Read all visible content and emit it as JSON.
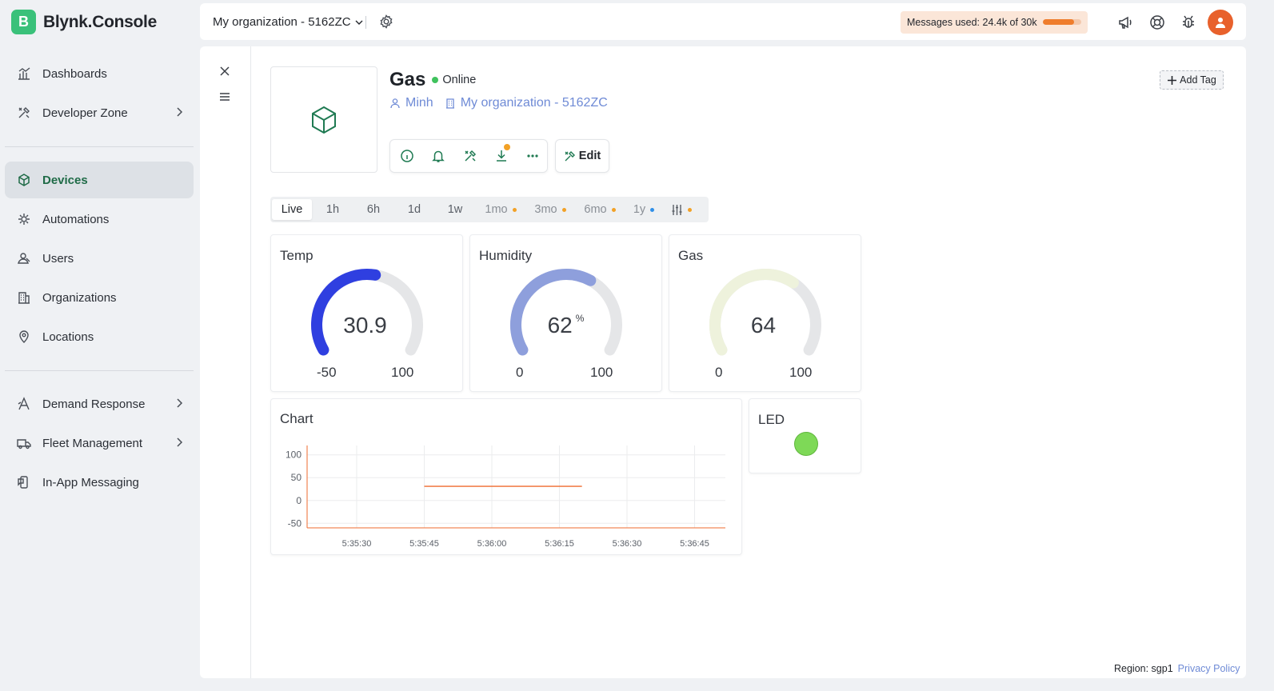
{
  "brand": {
    "logo_letter": "B",
    "name": "Blynk.Console",
    "color": "#3ac17a"
  },
  "sidebar": {
    "items": [
      {
        "label": "Dashboards",
        "icon": "dashboard-icon"
      },
      {
        "label": "Developer Zone",
        "icon": "tools-icon",
        "expandable": true
      },
      {
        "label": "Devices",
        "icon": "cube-icon",
        "active": true
      },
      {
        "label": "Automations",
        "icon": "automation-icon"
      },
      {
        "label": "Users",
        "icon": "users-icon"
      },
      {
        "label": "Organizations",
        "icon": "building-icon"
      },
      {
        "label": "Locations",
        "icon": "location-pin-icon"
      },
      {
        "label": "Demand Response",
        "icon": "demand-response-icon",
        "expandable": true
      },
      {
        "label": "Fleet Management",
        "icon": "truck-icon",
        "expandable": true
      },
      {
        "label": "In-App Messaging",
        "icon": "messaging-icon"
      }
    ]
  },
  "topbar": {
    "org_name": "My organization - 5162ZC",
    "messages_label": "Messages used: 24.4k of 30k",
    "messages_fraction": 0.81,
    "messages_color": "#ef7d2c"
  },
  "device": {
    "name": "Gas",
    "status": "Online",
    "status_color": "#3fc25d",
    "owner": "Minh",
    "organization": "My organization - 5162ZC",
    "edit_label": "Edit",
    "add_tag_label": "Add Tag"
  },
  "time_tabs": [
    {
      "label": "Live",
      "active": true
    },
    {
      "label": "1h"
    },
    {
      "label": "6h"
    },
    {
      "label": "1d"
    },
    {
      "label": "1w"
    },
    {
      "label": "1mo",
      "dim": true,
      "dot": "#f2a126"
    },
    {
      "label": "3mo",
      "dim": true,
      "dot": "#f2a126"
    },
    {
      "label": "6mo",
      "dim": true,
      "dot": "#f2a126"
    },
    {
      "label": "1y",
      "dim": true,
      "dot": "#2f8fe8"
    },
    {
      "label": "",
      "icon": "sliders-icon",
      "dot": "#f2a126"
    }
  ],
  "gauges": [
    {
      "title": "Temp",
      "value": "30.9",
      "unit": "",
      "min": "-50",
      "max": "100",
      "fraction": 0.539,
      "color": "#2f3fe0"
    },
    {
      "title": "Humidity",
      "value": "62",
      "unit": "%",
      "min": "0",
      "max": "100",
      "fraction": 0.62,
      "color": "#8e9fdc"
    },
    {
      "title": "Gas",
      "value": "64",
      "unit": "",
      "min": "0",
      "max": "100",
      "fraction": 0.64,
      "color": "#eef2dc"
    }
  ],
  "chart_card": {
    "title": "Chart"
  },
  "led_card": {
    "title": "LED",
    "color": "#7ed957"
  },
  "chart_data": {
    "type": "line",
    "title": "Chart",
    "x_ticks": [
      "5:35:30",
      "5:35:45",
      "5:36:00",
      "5:36:15",
      "5:36:30",
      "5:36:45"
    ],
    "y_ticks": [
      100,
      50,
      0,
      -50
    ],
    "ylim": [
      -60,
      110
    ],
    "grid": true,
    "series": [
      {
        "color": "#ef6b2f",
        "x": [
          "5:35:45",
          "5:36:00",
          "5:36:15",
          "5:36:20"
        ],
        "values": [
          31,
          31,
          31,
          31
        ]
      }
    ]
  },
  "footer": {
    "region": "Region: sgp1",
    "privacy": "Privacy Policy"
  }
}
